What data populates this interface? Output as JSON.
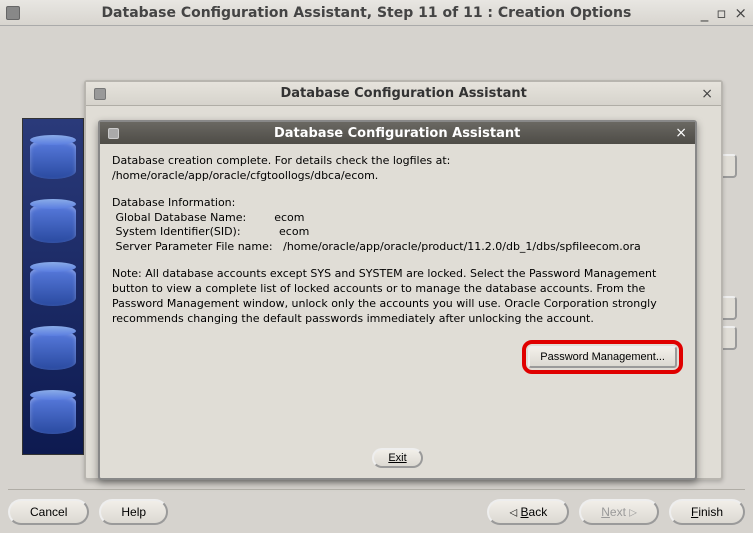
{
  "outer_window": {
    "title": "Database Configuration Assistant, Step 11 of 11 : Creation Options"
  },
  "mid_dialog": {
    "title": "Database Configuration Assistant"
  },
  "inner_dialog": {
    "title": "Database Configuration Assistant",
    "line1": "Database creation complete. For details check the logfiles at:",
    "logpath": " /home/oracle/app/oracle/cfgtoollogs/dbca/ecom.",
    "info_heading": "Database Information:",
    "row_gdn_label": " Global Database Name:",
    "row_gdn_value": "ecom",
    "row_sid_label": " System Identifier(SID):",
    "row_sid_value": "ecom",
    "row_spf_label": " Server Parameter File name:",
    "row_spf_value": "/home/oracle/app/oracle/product/11.2.0/db_1/dbs/spfileecom.ora",
    "note": "Note: All database accounts except SYS and SYSTEM are locked. Select the Password Management button to view a complete list of locked accounts or to manage the database accounts. From the Password Management window, unlock only the accounts you will use. Oracle Corporation strongly recommends changing the default passwords immediately after unlocking the account.",
    "pm_button": "Password Management...",
    "exit_button": "Exit"
  },
  "wizard": {
    "cancel": "Cancel",
    "help": "Help",
    "back": "Back",
    "next": "Next",
    "finish": "Finish"
  }
}
